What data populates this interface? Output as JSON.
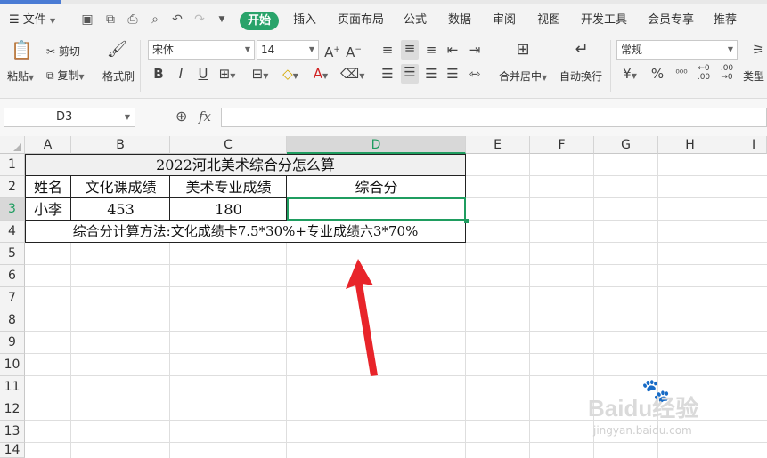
{
  "menubar": {
    "file_label": "文件",
    "tabs": [
      "开始",
      "插入",
      "页面布局",
      "公式",
      "数据",
      "审阅",
      "视图",
      "开发工具",
      "会员专享",
      "推荐"
    ]
  },
  "ribbon": {
    "paste_label": "粘贴",
    "cut_label": "剪切",
    "copy_label": "复制",
    "format_painter_label": "格式刷",
    "font_name": "宋体",
    "font_size": "14",
    "merge_label": "合并居中",
    "wrap_label": "自动换行",
    "number_format": "常规",
    "type_label": "类型",
    "currency_symbol": "¥",
    "percent_symbol": "%"
  },
  "formula_bar": {
    "cell_ref": "D3",
    "fx": "fx",
    "formula": ""
  },
  "sheet": {
    "columns": [
      "A",
      "B",
      "C",
      "D",
      "E",
      "F",
      "G",
      "H",
      "I"
    ],
    "rows": [
      "1",
      "2",
      "3",
      "4",
      "5",
      "6",
      "7",
      "8",
      "9",
      "10",
      "11",
      "12",
      "13",
      "14"
    ],
    "title": "2022河北美术综合分怎么算",
    "header": [
      "姓名",
      "文化课成绩",
      "美术专业成绩",
      "综合分"
    ],
    "record": [
      "小李",
      "453",
      "180",
      ""
    ],
    "note": "综合分计算方法:文化成绩卡7.5*30%+专业成绩六3*70%"
  },
  "watermark": {
    "brand": "Baidu经验",
    "url": "jingyan.baidu.com"
  },
  "colors": {
    "accent": "#29a36a",
    "selection": "#1f9d60",
    "arrow": "#e8242a"
  }
}
